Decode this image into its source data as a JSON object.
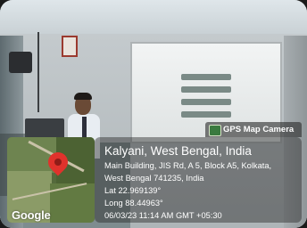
{
  "badge": {
    "icon": "gps-map-camera-icon",
    "label": "GPS Map Camera"
  },
  "map": {
    "logo": "Google",
    "pin_color": "#e0322c"
  },
  "location": {
    "title": "Kalyani, West Bengal, India",
    "address_line1": "Main Building, JIS Rd, A 5, Block A5, Kolkata,",
    "address_line2": "West Bengal 741235, India",
    "latitude": "Lat 22.969139°",
    "longitude": "Long 88.44963°",
    "timestamp": "06/03/23 11:14 AM GMT +05:30"
  }
}
